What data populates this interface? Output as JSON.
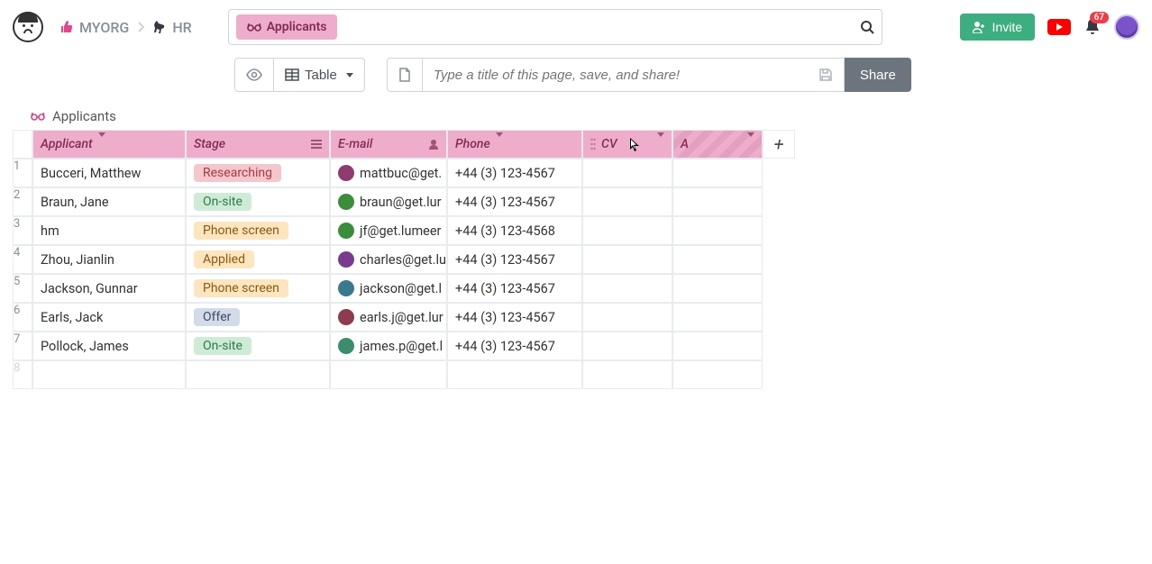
{
  "breadcrumb": {
    "org_label": "MYORG",
    "project_label": "HR"
  },
  "search": {
    "chip_label": "Applicants",
    "placeholder": ""
  },
  "topright": {
    "invite_label": "Invite",
    "notification_count": "67"
  },
  "toolbar": {
    "view_label": "Table",
    "title_placeholder": "Type a title of this page, save, and share!",
    "share_label": "Share"
  },
  "table": {
    "title": "Applicants",
    "columns": {
      "applicant": "Applicant",
      "stage": "Stage",
      "email": "E-mail",
      "phone": "Phone",
      "cv": "CV",
      "a": "A"
    },
    "stage_colors": {
      "Researching": {
        "bg": "#f4c7cd",
        "fg": "#a83944"
      },
      "On-site": {
        "bg": "#cdebd6",
        "fg": "#2f7a45"
      },
      "Phone screen": {
        "bg": "#fde6bf",
        "fg": "#8a5a12"
      },
      "Applied": {
        "bg": "#fde6bf",
        "fg": "#8a5a12"
      },
      "Offer": {
        "bg": "#d4dbe8",
        "fg": "#3a4a6b"
      }
    },
    "avatar_colors": [
      "#8e3b6f",
      "#3a8e3b",
      "#3a8e3b",
      "#7a3b8e",
      "#3b7a8e",
      "#8e3b4f",
      "#3a8e6b"
    ],
    "rows": [
      {
        "n": "1",
        "applicant": "Bucceri, Matthew",
        "stage": "Researching",
        "email": "mattbuc@get.",
        "phone": "+44 (3) 123-4567"
      },
      {
        "n": "2",
        "applicant": "Braun, Jane",
        "stage": "On-site",
        "email": "braun@get.lur",
        "phone": "+44 (3) 123-4567"
      },
      {
        "n": "3",
        "applicant": "hm",
        "stage": "Phone screen",
        "email": "jf@get.lumeer",
        "phone": "+44 (3) 123-4568"
      },
      {
        "n": "4",
        "applicant": "Zhou, Jianlin",
        "stage": "Applied",
        "email": "charles@get.lu",
        "phone": "+44 (3) 123-4567"
      },
      {
        "n": "5",
        "applicant": "Jackson, Gunnar",
        "stage": "Phone screen",
        "email": "jackson@get.l",
        "phone": "+44 (3) 123-4567"
      },
      {
        "n": "6",
        "applicant": "Earls, Jack",
        "stage": "Offer",
        "email": "earls.j@get.lur",
        "phone": "+44 (3) 123-4567"
      },
      {
        "n": "7",
        "applicant": "Pollock, James",
        "stage": "On-site",
        "email": "james.p@get.l",
        "phone": "+44 (3) 123-4567"
      }
    ]
  }
}
